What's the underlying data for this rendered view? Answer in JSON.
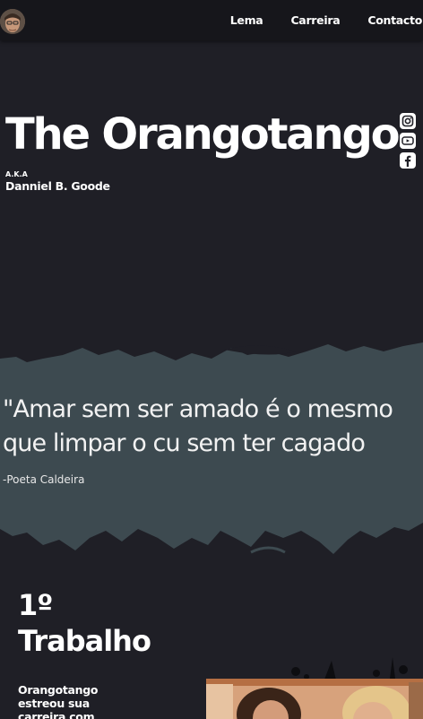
{
  "nav": {
    "avatar": "profile-photo",
    "links": [
      {
        "label": "Lema"
      },
      {
        "label": "Carreira"
      },
      {
        "label": "Contacto"
      }
    ]
  },
  "hero": {
    "title": "The Orangotango",
    "aka_label": "A.K.A",
    "aka_name": "Danniel B. Goode",
    "social_icons": [
      "instagram-icon",
      "youtube-icon",
      "facebook-icon"
    ]
  },
  "quote": {
    "text_line1": "\"Amar sem ser amado é o mesmo",
    "text_line2": "que limpar o cu sem ter cagado",
    "author": "-Poeta Caldeira"
  },
  "work": {
    "title_line1": "1º",
    "title_line2": "Trabalho",
    "text": "Orangotango estreou sua carreira com"
  },
  "colors": {
    "background": "#1f1f26",
    "nav": "#16161b",
    "quote_band": "#3d4a50",
    "text": "#ffffff"
  }
}
